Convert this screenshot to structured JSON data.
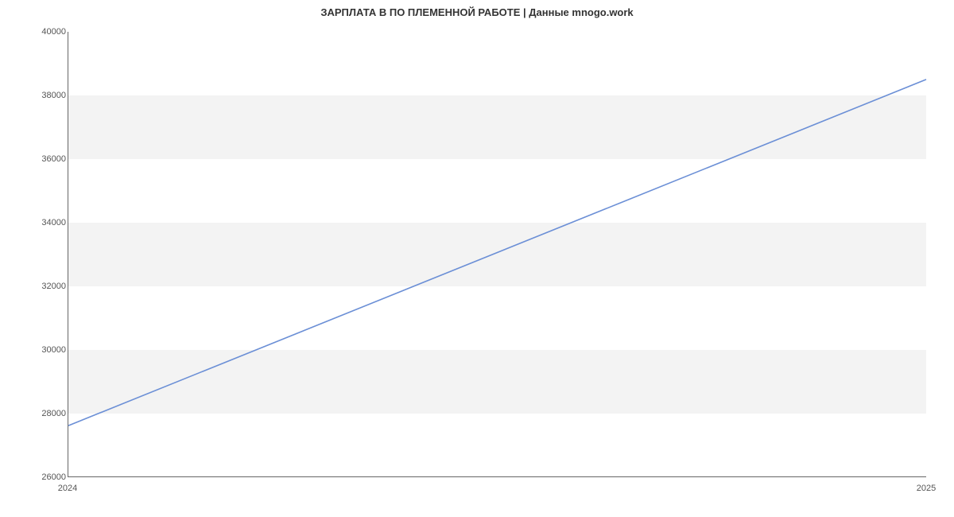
{
  "chart_data": {
    "type": "line",
    "title": "ЗАРПЛАТА В ПО ПЛЕМЕННОЙ РАБОТЕ | Данные mnogo.work",
    "x": [
      2024,
      2025
    ],
    "values": [
      27600,
      38500
    ],
    "xlabel": "",
    "ylabel": "",
    "xlim": [
      2024,
      2025
    ],
    "ylim": [
      26000,
      40000
    ],
    "y_ticks": [
      26000,
      28000,
      30000,
      32000,
      34000,
      36000,
      38000,
      40000
    ],
    "x_ticks": [
      2024,
      2025
    ],
    "line_color": "#6b8fd6",
    "band_color": "#f3f3f3"
  }
}
